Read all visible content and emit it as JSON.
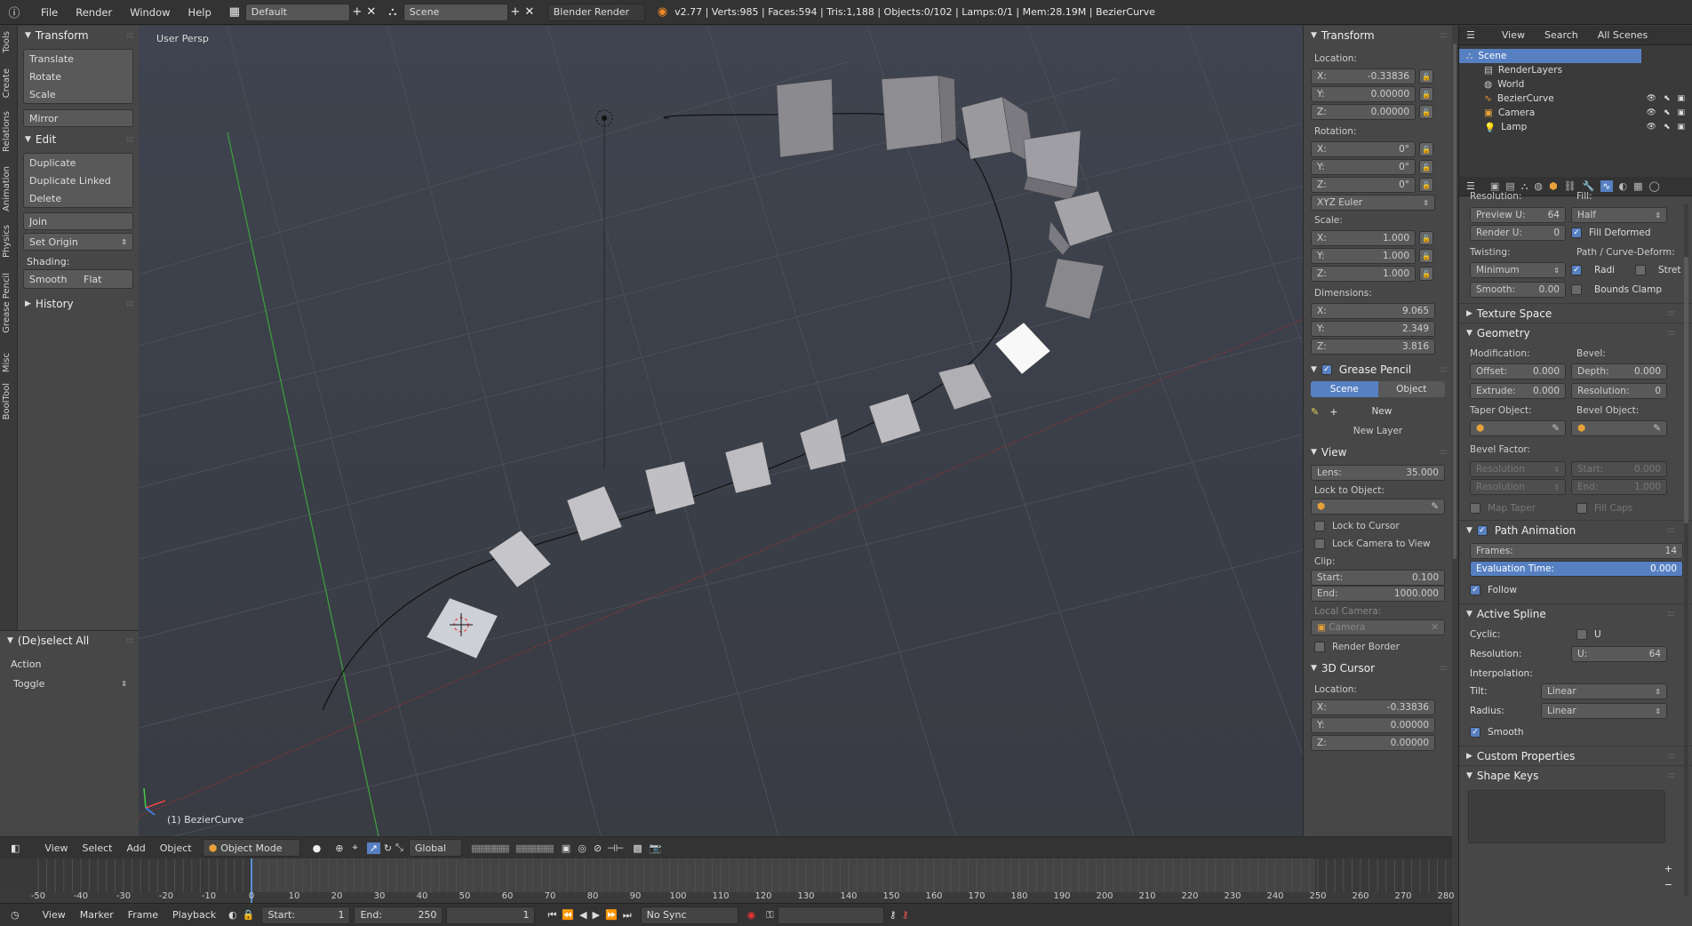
{
  "topbar": {
    "menus": [
      "File",
      "Render",
      "Window",
      "Help"
    ],
    "screen_layout": "Default",
    "scene": "Scene",
    "engine": "Blender Render",
    "stats": "v2.77 | Verts:985 | Faces:594 | Tris:1,188 | Objects:0/102 | Lamps:0/1 | Mem:28.19M | BezierCurve"
  },
  "tool_tabs": [
    "Tools",
    "Create",
    "Relations",
    "Animation",
    "Physics",
    "Grease Pencil",
    "Misc",
    "BoolTool"
  ],
  "toolshelf": {
    "transform_title": "Transform",
    "transform_items": [
      "Translate",
      "Rotate",
      "Scale"
    ],
    "mirror": "Mirror",
    "edit_title": "Edit",
    "edit_items": [
      "Duplicate",
      "Duplicate Linked",
      "Delete"
    ],
    "join": "Join",
    "set_origin": "Set Origin",
    "shading_label": "Shading:",
    "smooth": "Smooth",
    "flat": "Flat",
    "history_title": "History"
  },
  "operator": {
    "title": "(De)select All",
    "action_label": "Action",
    "action_value": "Toggle"
  },
  "viewport": {
    "view_name": "User Persp",
    "object_label": "(1) BezierCurve"
  },
  "npanel": {
    "transform_title": "Transform",
    "location_label": "Location:",
    "location": [
      {
        "axis": "X:",
        "value": "-0.33836"
      },
      {
        "axis": "Y:",
        "value": "0.00000"
      },
      {
        "axis": "Z:",
        "value": "0.00000"
      }
    ],
    "rotation_label": "Rotation:",
    "rotation": [
      {
        "axis": "X:",
        "value": "0°"
      },
      {
        "axis": "Y:",
        "value": "0°"
      },
      {
        "axis": "Z:",
        "value": "0°"
      }
    ],
    "rotation_mode": "XYZ Euler",
    "scale_label": "Scale:",
    "scale": [
      {
        "axis": "X:",
        "value": "1.000"
      },
      {
        "axis": "Y:",
        "value": "1.000"
      },
      {
        "axis": "Z:",
        "value": "1.000"
      }
    ],
    "dimensions_label": "Dimensions:",
    "dimensions": [
      {
        "axis": "X:",
        "value": "9.065"
      },
      {
        "axis": "Y:",
        "value": "2.349"
      },
      {
        "axis": "Z:",
        "value": "3.816"
      }
    ],
    "grease_title": "Grease Pencil",
    "gp_tab_scene": "Scene",
    "gp_tab_object": "Object",
    "gp_new": "New",
    "gp_new_layer": "New Layer",
    "view_title": "View",
    "lens_label": "Lens:",
    "lens_value": "35.000",
    "lock_object_label": "Lock to Object:",
    "lock_cursor": "Lock to Cursor",
    "lock_camera": "Lock Camera to View",
    "clip_label": "Clip:",
    "clip_start_label": "Start:",
    "clip_start": "0.100",
    "clip_end_label": "End:",
    "clip_end": "1000.000",
    "local_camera_label": "Local Camera:",
    "local_camera": "Camera",
    "render_border": "Render Border",
    "cursor_title": "3D Cursor",
    "cursor_location_label": "Location:",
    "cursor_location": [
      {
        "axis": "X:",
        "value": "-0.33836"
      },
      {
        "axis": "Y:",
        "value": "0.00000"
      },
      {
        "axis": "Z:",
        "value": "0.00000"
      }
    ]
  },
  "outliner": {
    "menu": [
      "View",
      "Search"
    ],
    "filter": "All Scenes",
    "items": [
      {
        "name": "Scene",
        "indent": 0
      },
      {
        "name": "RenderLayers",
        "indent": 1
      },
      {
        "name": "World",
        "indent": 1
      },
      {
        "name": "BezierCurve",
        "indent": 1
      },
      {
        "name": "Camera",
        "indent": 1
      },
      {
        "name": "Lamp",
        "indent": 1
      }
    ]
  },
  "props": {
    "resolution_label": "Resolution:",
    "fill_label": "Fill:",
    "preview_u_label": "Preview U:",
    "preview_u": "64",
    "render_u_label": "Render U:",
    "render_u": "0",
    "fill_value": "Half",
    "fill_deformed": "Fill Deformed",
    "twisting_label": "Twisting:",
    "path_deform_label": "Path / Curve-Deform:",
    "twisting_value": "Minimum",
    "radius": "Radi",
    "stretch": "Stret",
    "smooth_label": "Smooth:",
    "smooth_value": "0.00",
    "bounds_clamp": "Bounds Clamp",
    "texture_space": "Texture Space",
    "geometry": "Geometry",
    "modification_label": "Modification:",
    "bevel_label": "Bevel:",
    "offset_label": "Offset:",
    "offset_value": "0.000",
    "depth_label": "Depth:",
    "depth_value": "0.000",
    "extrude_label": "Extrude:",
    "extrude_value": "0.000",
    "bevel_res_label": "Resolution:",
    "bevel_res_value": "0",
    "taper_label": "Taper Object:",
    "bevel_object_label": "Bevel Object:",
    "bevel_factor_label": "Bevel Factor:",
    "bf_resolution1": "Resolution",
    "bf_start_label": "Start:",
    "bf_start": "0.000",
    "bf_resolution2": "Resolution",
    "bf_end_label": "End:",
    "bf_end": "1.000",
    "map_taper": "Map Taper",
    "fill_caps": "Fill Caps",
    "path_animation": "Path Animation",
    "frames_label": "Frames:",
    "frames_value": "14",
    "eval_time_label": "Evaluation Time:",
    "eval_time_value": "0.000",
    "follow": "Follow",
    "active_spline": "Active Spline",
    "cyclic_label": "Cyclic:",
    "cyclic_u": "U",
    "as_resolution_label": "Resolution:",
    "as_u_label": "U:",
    "as_u_value": "64",
    "interpolation_label": "Interpolation:",
    "tilt_label": "Tilt:",
    "tilt_value": "Linear",
    "radius_label": "Radius:",
    "radius_value": "Linear",
    "as_smooth": "Smooth",
    "custom_properties": "Custom Properties",
    "shape_keys": "Shape Keys"
  },
  "header3d": {
    "view": "View",
    "select": "Select",
    "add": "Add",
    "object": "Object",
    "mode": "Object Mode",
    "orientation": "Global"
  },
  "timeline": {
    "ticks": [
      "-50",
      "-40",
      "-30",
      "-20",
      "-10",
      "0",
      "10",
      "20",
      "30",
      "40",
      "50",
      "60",
      "70",
      "80",
      "90",
      "100",
      "110",
      "120",
      "130",
      "140",
      "150",
      "160",
      "170",
      "180",
      "190",
      "200",
      "210",
      "220",
      "230",
      "240",
      "250",
      "260",
      "270",
      "280"
    ],
    "view": "View",
    "marker": "Marker",
    "frame": "Frame",
    "playback": "Playback",
    "start_label": "Start:",
    "start": "1",
    "end_label": "End:",
    "end": "250",
    "current": "1",
    "sync": "No Sync"
  }
}
